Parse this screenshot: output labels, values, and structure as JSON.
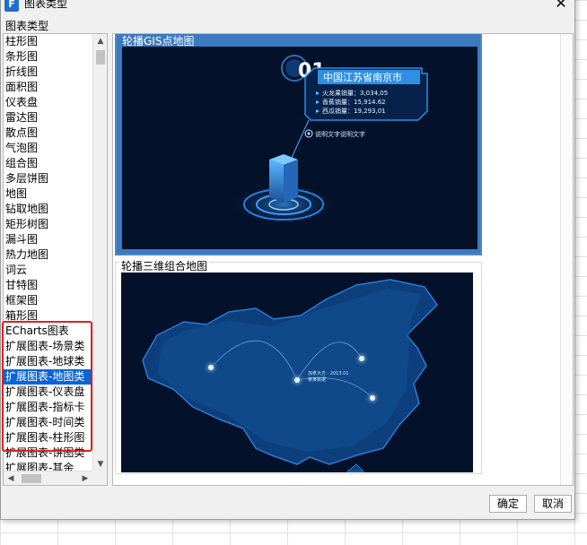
{
  "window": {
    "title": "图表类型",
    "close_label": "✕"
  },
  "section_label": "图表类型",
  "chart_types": [
    "柱形图",
    "条形图",
    "折线图",
    "面积图",
    "仪表盘",
    "雷达图",
    "散点图",
    "气泡图",
    "组合图",
    "多层饼图",
    "地图",
    "钻取地图",
    "矩形树图",
    "漏斗图",
    "热力地图",
    "词云",
    "甘特图",
    "框架图",
    "箱形图",
    "ECharts图表",
    "扩展图表-场景类",
    "扩展图表-地球类",
    "扩展图表-地图类",
    "扩展图表-仪表盘",
    "扩展图表-指标卡",
    "扩展图表-时间类",
    "扩展图表-柱形图",
    "扩展图表-饼图类",
    "扩展图表-其余"
  ],
  "selected_index": 22,
  "preview": {
    "card1": {
      "title": "轮播GIS点地图",
      "index_label": "01",
      "location": "中国江苏省南京市",
      "stats": [
        "火龙果销量：3,034,05",
        "香蕉销量：15,914.62",
        "西瓜销量：19,293,01"
      ],
      "note": "说明文字说明文字"
    },
    "card2": {
      "title": "轮播三维组合地图",
      "label_a": "加拿大方 · 2013.01",
      "label_b": "某某数据"
    }
  },
  "buttons": {
    "ok": "确定",
    "cancel": "取消"
  },
  "colors": {
    "selection": "#0a64d6",
    "highlight_border": "#e02020",
    "map_bg": "#04112b",
    "card_selected": "#3c7ac0"
  }
}
